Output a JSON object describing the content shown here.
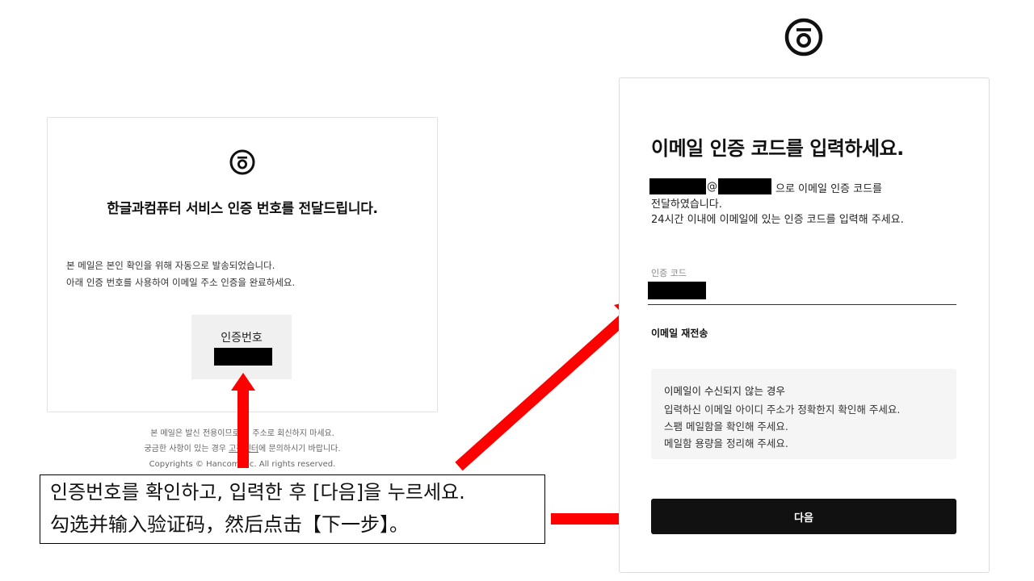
{
  "email": {
    "title": "한글과컴퓨터 서비스 인증 번호를 전달드립니다.",
    "body_line1": "본 메일은 본인 확인을 위해 자동으로 발송되었습니다.",
    "body_line2": "아래 인증 번호를 사용하여 이메일 주소 인증을 완료하세요.",
    "code_label": "인증번호",
    "footer_line1": "본 메일은 발신 전용이므로 이 주소로 회신하지 마세요.",
    "footer_line2_a": "궁금한 사항이 있는 경우 ",
    "footer_line2_link": "고객센터",
    "footer_line2_b": "에 문의하시기 바랍니다.",
    "footer_line3": "Copyrights © Hancom Inc. All rights reserved."
  },
  "instruction": {
    "line1": "인증번호를 확인하고, 입력한 후 [다음]을 누르세요.",
    "line2": "勾选并输入验证码，然后点击【下一步】。"
  },
  "verify": {
    "title": "이메일 인증 코드를 입력하세요.",
    "at_sign": "@",
    "desc_tail": "으로 이메일 인증 코드를",
    "desc_line2": "전달하였습니다.",
    "desc_line3": "24시간 이내에 이메일에 있는 인증 코드를 입력해 주세요.",
    "code_field_label": "인증 코드",
    "resend_label": "이메일 재전송",
    "info_title": "이메일이 수신되지 않는 경우",
    "info_items": [
      "입력하신 이메일 아이디 주소가 정확한지 확인해 주세요.",
      "스팸 메일함을 확인해 주세요.",
      "메일함 용량을 정리해 주세요."
    ],
    "next_label": "다음"
  },
  "colors": {
    "arrow": "#ff0000",
    "button_bg": "#111111",
    "redaction": "#000000",
    "info_bg": "#f5f5f5"
  },
  "icons": [
    "hancom-logo-icon",
    "arrow-up-icon",
    "arrow-diagonal-icon",
    "arrow-right-icon"
  ]
}
